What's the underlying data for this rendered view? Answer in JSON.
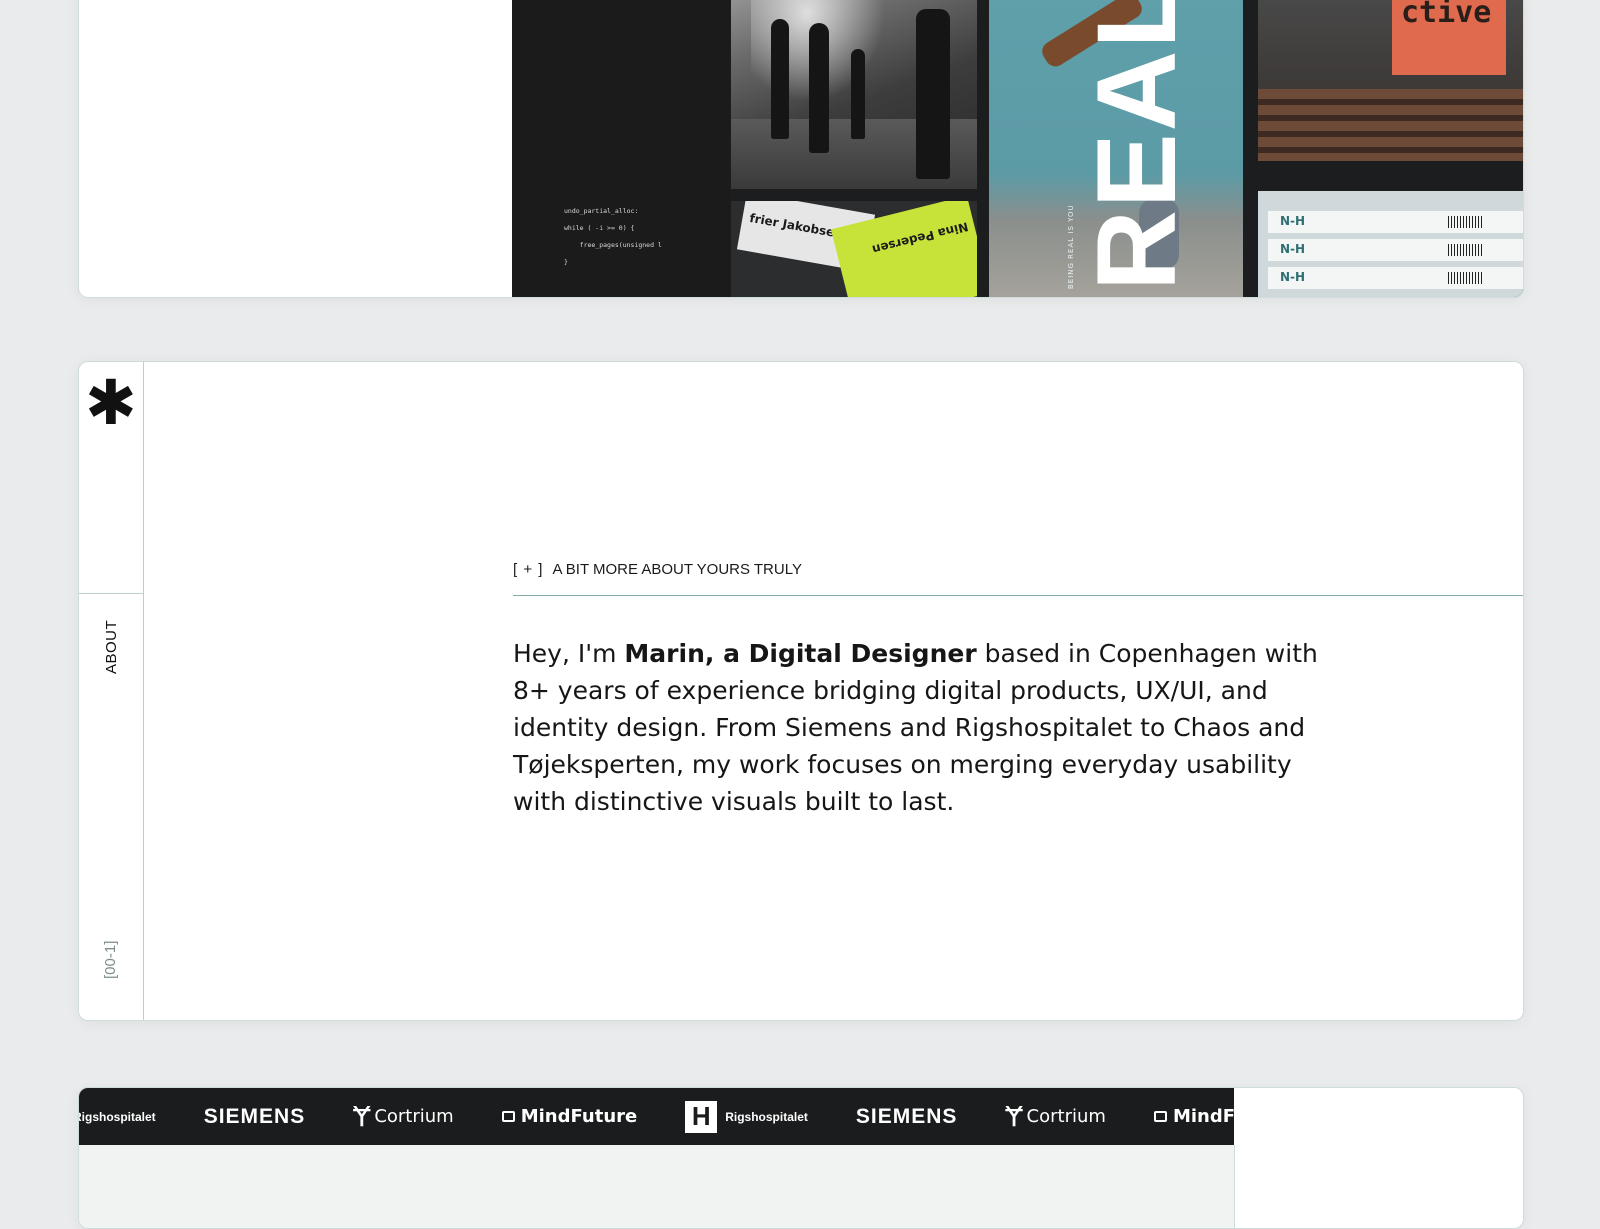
{
  "work_preview": {
    "code_lines": [
      "undo_partial_alloc:",
      "while ( -i >= 0) {",
      "    free_pages(unsigned l",
      "}"
    ],
    "card_name_1": "frier Jakobsen",
    "card_name_2": "Nina Pedersen",
    "poster_word": "REAL",
    "poster_tagline": "BEING REAL IS YOU",
    "poster_word_2": "ctive",
    "ticket_logo": "N-H"
  },
  "about": {
    "side_label": "ABOUT",
    "side_index": "[00-1]",
    "heading_bracket": "[ + ]",
    "heading": "A BIT MORE ABOUT YOURS TRULY",
    "intro_pre": "Hey, I'm ",
    "intro_bold": "Marin, a Digital Designer",
    "intro_post": " based in Copenhagen with 8+ years of experience bridging digital products, UX/UI, and identity design. From Siemens and Rigshospitalet to Chaos and Tøjeksperten, my work focuses on merging everyday usability with distinctive visuals built to last."
  },
  "clients": {
    "logos": [
      "Rigshospitalet",
      "SIEMENS",
      "Cortrium",
      "MindFuture",
      "Rigshospitalet",
      "SIEMENS",
      "Cortrium",
      "MindFuture"
    ]
  },
  "colors": {
    "page_background": "#e9ebec",
    "card_border": "#cfdcdc",
    "accent_rule": "#86aba9",
    "marquee_background": "#1a1c1d"
  }
}
